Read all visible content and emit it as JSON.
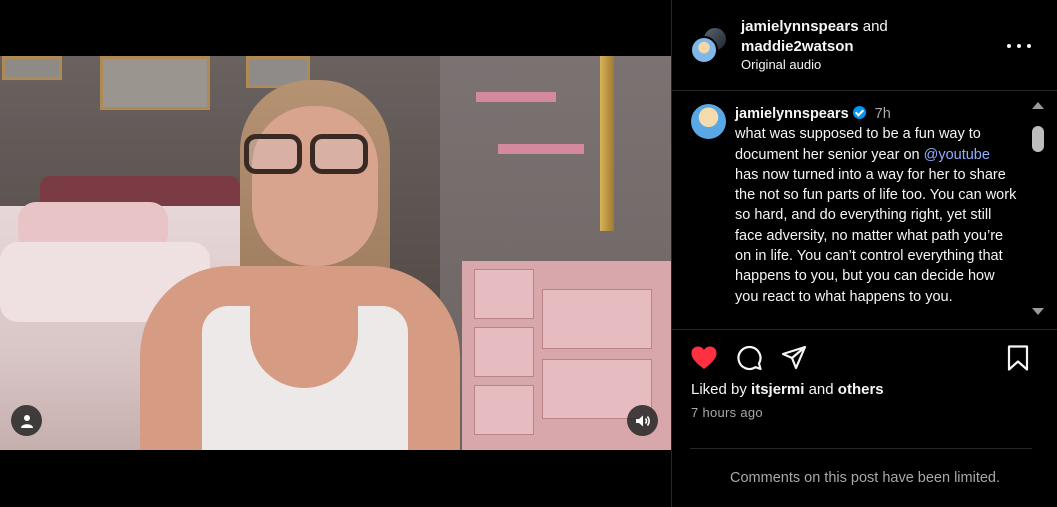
{
  "header": {
    "user1": "jamielynnspears",
    "and_text": "and",
    "user2": "maddie2watson",
    "audio": "Original audio",
    "more_icon": "more-horizontal-icon"
  },
  "caption": {
    "username": "jamielynnspears",
    "verified": true,
    "time": "7h",
    "text_before": "what was supposed to be a fun way to document her senior year on",
    "mention": "@youtube",
    "text_after": "has now turned into a way for her to share the not so fun parts of life too. You can work so hard, and do everything right, yet still face adversity, no matter what path you’re on in life. You can’t control everything that happens to you, but you can decide how you react to what happens to you."
  },
  "actions": {
    "like_icon": "heart-filled-icon",
    "comment_icon": "comment-icon",
    "share_icon": "paper-plane-icon",
    "save_icon": "bookmark-icon",
    "like_color": "#ff3040"
  },
  "likes": {
    "prefix": "Liked by",
    "user": "itsjermi",
    "and_text": "and",
    "others": "others"
  },
  "post_time": "7 hours ago",
  "comments_notice": "Comments on this post have been limited.",
  "video": {
    "user_icon": "user-icon",
    "sound_icon": "speaker-icon"
  }
}
